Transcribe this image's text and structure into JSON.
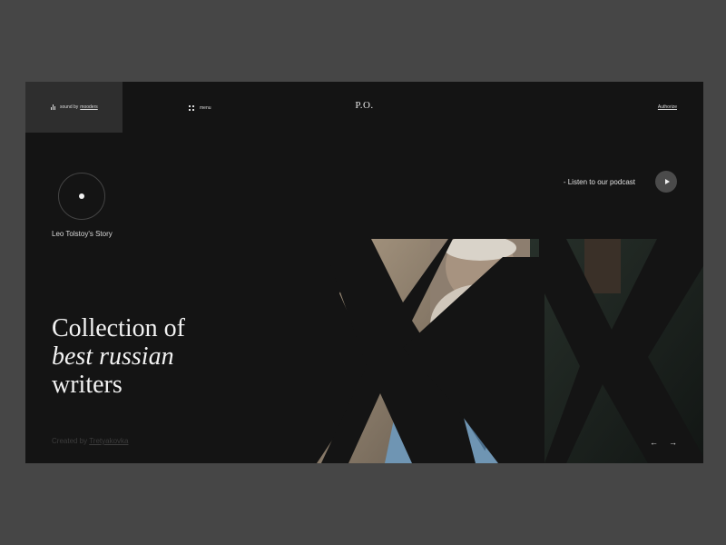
{
  "header": {
    "sound_prefix": "sound by",
    "sound_link": "mooders",
    "menu_label": "menu",
    "logo": "P.O.",
    "authorize_label": "Authorize"
  },
  "story": {
    "label": "Leo Tolstoy's Story"
  },
  "podcast": {
    "label": "- Listen to our podcast"
  },
  "headline": {
    "line1": "Collection of",
    "line2": "best russian",
    "line3": "writers"
  },
  "credit": {
    "prefix": "Created by",
    "link": "Tretyakovka"
  },
  "navigation": {
    "prev": "←",
    "next": "→"
  },
  "colors": {
    "outer_bg": "#464646",
    "panel_bg": "#141414",
    "sound_box_bg": "#2e2e2e",
    "play_button_bg": "#4b4b4b",
    "portrait_shirt": "#6f95b3"
  },
  "icons": [
    "equalizer-icon",
    "grid-menu-icon",
    "play-icon",
    "arrow-left-icon",
    "arrow-right-icon"
  ]
}
